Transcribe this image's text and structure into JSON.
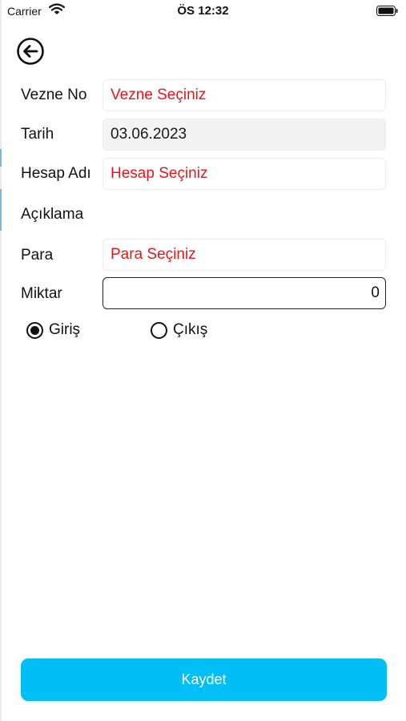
{
  "status_bar": {
    "carrier": "Carrier",
    "time": "ÖS 12:32"
  },
  "nav": {
    "back_icon": "arrow-left-circle-icon"
  },
  "form": {
    "vezne_no": {
      "label": "Vezne No",
      "value": "Vezne Seçiniz"
    },
    "tarih": {
      "label": "Tarih",
      "value": "03.06.2023"
    },
    "hesap_adi": {
      "label": "Hesap Adı",
      "value": "Hesap Seçiniz"
    },
    "aciklama": {
      "label": "Açıklama"
    },
    "para": {
      "label": "Para",
      "value": "Para Seçiniz"
    },
    "miktar": {
      "label": "Miktar",
      "value": "0"
    },
    "direction": {
      "options": [
        "Giriş",
        "Çıkış"
      ],
      "selected": "Giriş"
    }
  },
  "actions": {
    "save_label": "Kaydet"
  },
  "colors": {
    "placeholder": "#e8161a",
    "primary_button": "#00bff6"
  }
}
